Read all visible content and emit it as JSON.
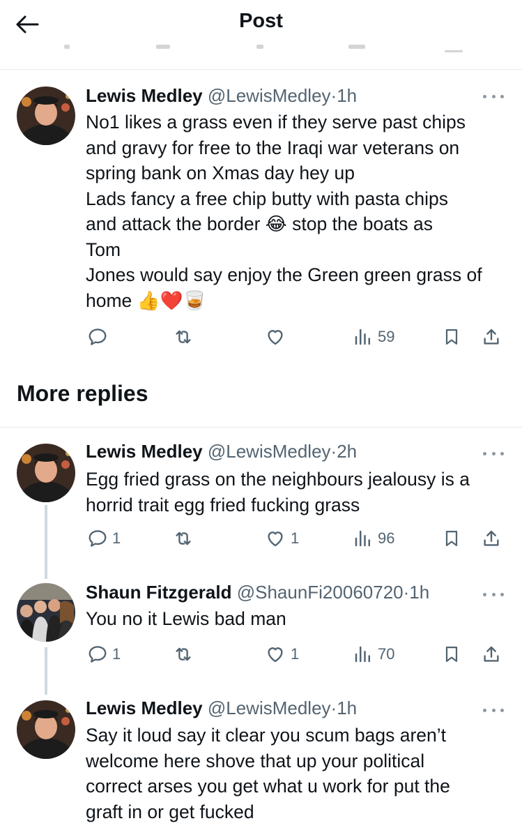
{
  "header": {
    "title": "Post"
  },
  "main_post": {
    "author_name": "Lewis Medley",
    "author_handle": "@LewisMedley",
    "time": "1h",
    "text": "No1 likes a grass even if they serve past chips\nand gravy for free to the Iraqi war veterans on\nspring bank on Xmas day hey up\nLads fancy a free chip butty with pasta chips\nand attack the border 😂 stop the boats as\nTom\nJones would say enjoy the Green green grass of\nhome 👍❤️🥃",
    "views": "59"
  },
  "more_replies": {
    "title": "More replies"
  },
  "replies": [
    {
      "author_name": "Lewis Medley",
      "author_handle": "@LewisMedley",
      "time": "2h",
      "text": "Egg fried grass on the neighbours jealousy is a\nhorrid trait egg fried fucking grass",
      "reply_count": "1",
      "like_count": "1",
      "views": "96"
    },
    {
      "author_name": "Shaun Fitzgerald",
      "author_handle": "@ShaunFi20060720",
      "time": "1h",
      "text": "You no it Lewis bad man",
      "reply_count": "1",
      "like_count": "1",
      "views": "70"
    },
    {
      "author_name": "Lewis Medley",
      "author_handle": "@LewisMedley",
      "time": "1h",
      "text": "Say it loud say it clear you scum bags aren’t\nwelcome here shove that up your political\ncorrect arses you get what u work for put the\ngraft in or get fucked"
    }
  ],
  "colors": {
    "text_primary": "#0f1419",
    "text_secondary": "#536471",
    "divider": "#e7e9ea",
    "thread_line": "#cfd9de"
  },
  "icons": [
    "back-arrow-icon",
    "more-icon",
    "reply-icon",
    "repost-icon",
    "like-icon",
    "views-icon",
    "bookmark-icon",
    "share-icon"
  ]
}
